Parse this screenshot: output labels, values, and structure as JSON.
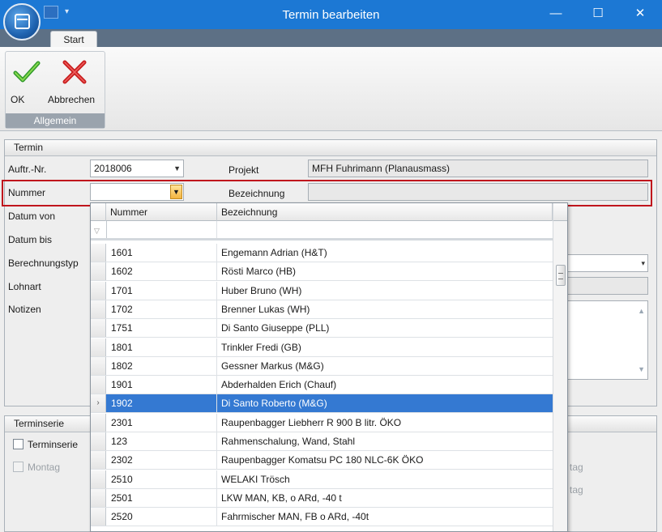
{
  "window": {
    "title": "Termin bearbeiten",
    "minimize_glyph": "—",
    "maximize_glyph": "☐",
    "close_glyph": "✕"
  },
  "ribbon": {
    "tab_label": "Start",
    "group_label": "Allgemein",
    "ok_label": "OK",
    "cancel_label": "Abbrechen",
    "ok_icon": "checkmark-icon",
    "cancel_icon": "red-x-icon"
  },
  "termin": {
    "title": "Termin",
    "auftr_label": "Auftr.-Nr.",
    "auftr_value": "2018006",
    "projekt_label": "Projekt",
    "projekt_value": "MFH Fuhrimann (Planausmass)",
    "nummer_label": "Nummer",
    "nummer_value": "",
    "bezeichnung_label": "Bezeichnung",
    "bezeichnung_value": "",
    "datum_von_label": "Datum von",
    "datum_bis_label": "Datum bis",
    "berechnungstyp_label": "Berechnungstyp",
    "lohnart_label": "Lohnart",
    "notizen_label": "Notizen"
  },
  "terminserie": {
    "title": "Terminserie",
    "checkbox_label": "Terminserie",
    "montag_label": "Montag",
    "right_partial_1": "tag",
    "right_partial_2": "tag"
  },
  "lookup": {
    "columns": [
      "Nummer",
      "Bezeichnung"
    ],
    "selected_index": 8,
    "rows": [
      {
        "nummer": "1601",
        "bezeichnung": "Engemann Adrian (H&T)"
      },
      {
        "nummer": "1602",
        "bezeichnung": "Rösti Marco (HB)"
      },
      {
        "nummer": "1701",
        "bezeichnung": "Huber Bruno (WH)"
      },
      {
        "nummer": "1702",
        "bezeichnung": "Brenner Lukas (WH)"
      },
      {
        "nummer": "1751",
        "bezeichnung": "Di Santo Giuseppe (PLL)"
      },
      {
        "nummer": "1801",
        "bezeichnung": "Trinkler Fredi (GB)"
      },
      {
        "nummer": "1802",
        "bezeichnung": "Gessner Markus (M&G)"
      },
      {
        "nummer": "1901",
        "bezeichnung": "Abderhalden Erich (Chauf)"
      },
      {
        "nummer": "1902",
        "bezeichnung": "Di Santo Roberto (M&G)"
      },
      {
        "nummer": "2301",
        "bezeichnung": "Raupenbagger Liebherr R 900 B litr. ÖKO"
      },
      {
        "nummer": "123",
        "bezeichnung": "Rahmenschalung, Wand, Stahl"
      },
      {
        "nummer": "2302",
        "bezeichnung": "Raupenbagger Komatsu PC 180 NLC-6K ÖKO"
      },
      {
        "nummer": "2510",
        "bezeichnung": "WELAKI Trösch"
      },
      {
        "nummer": "2501",
        "bezeichnung": "LKW MAN, KB, o ARd, -40 t"
      },
      {
        "nummer": "2520",
        "bezeichnung": "Fahrmischer MAN, FB o ARd, -40t"
      }
    ]
  },
  "colors": {
    "titlebar": "#1c78d4",
    "selection": "#3479d2",
    "highlight_frame": "#c0151c"
  }
}
